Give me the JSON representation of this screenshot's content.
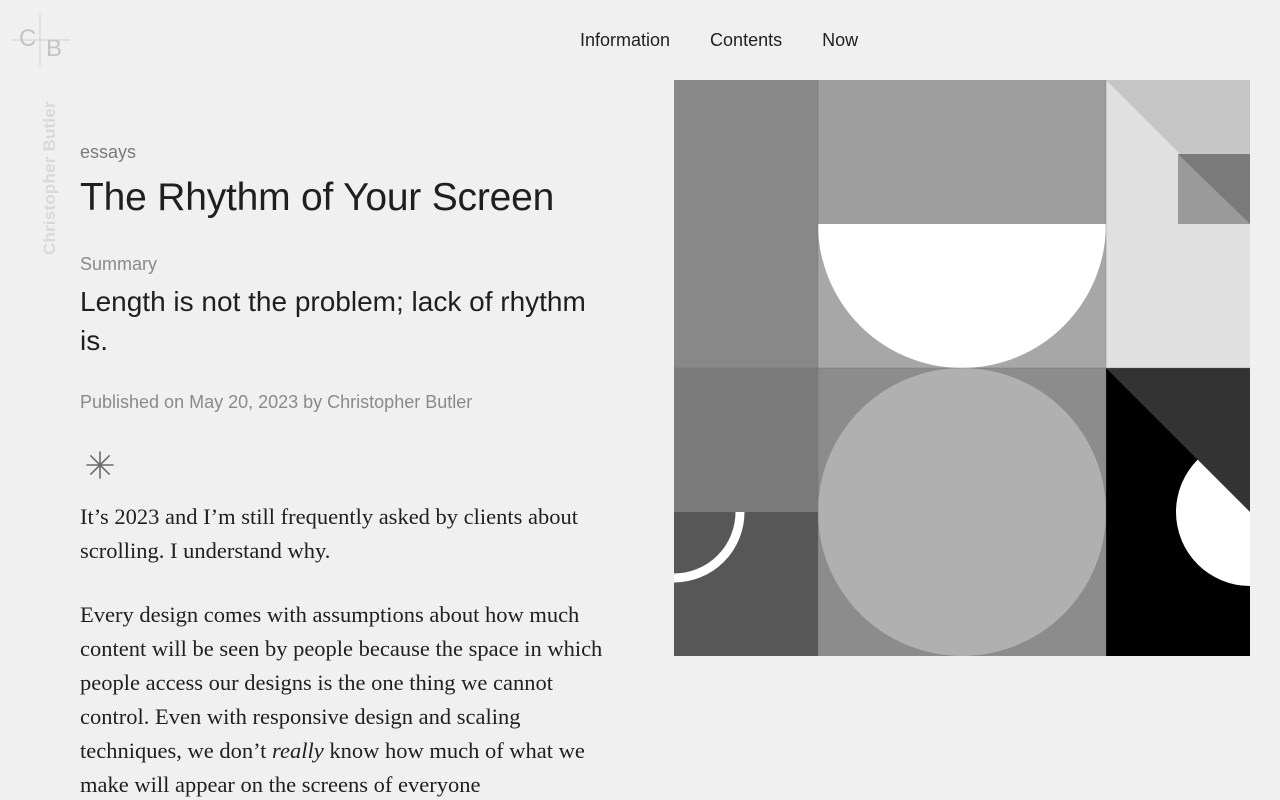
{
  "site": {
    "logo_letters": [
      "C",
      "B"
    ],
    "vertical_name": "Christopher Butler"
  },
  "nav": {
    "items": [
      {
        "label": "Information"
      },
      {
        "label": "Contents"
      },
      {
        "label": "Now"
      }
    ]
  },
  "article": {
    "category": "essays",
    "title": "The Rhythm of Your Screen",
    "summary_label": "Summary",
    "summary": "Length is not the problem; lack of rhythm is.",
    "published": "Published on May 20, 2023 by Christopher Butler",
    "divider_icon": "asterisk-icon",
    "paragraphs": {
      "p1": "It’s 2023 and I’m still frequently asked by clients about scrolling. I understand why.",
      "p2_before": "Every design comes with assumptions about how much content will be seen by people because the space in which people access our designs is the one thing we cannot control. Even with responsive design and scaling techniques, we don’t ",
      "p2_em": "really",
      "p2_after": " know how much of what we make will appear on the screens of everyone"
    }
  },
  "colors": {
    "background": "#f0f0f0",
    "text": "#1f1f1f",
    "muted": "#8a8a8a",
    "vertical_name": "#d9d9d9"
  }
}
